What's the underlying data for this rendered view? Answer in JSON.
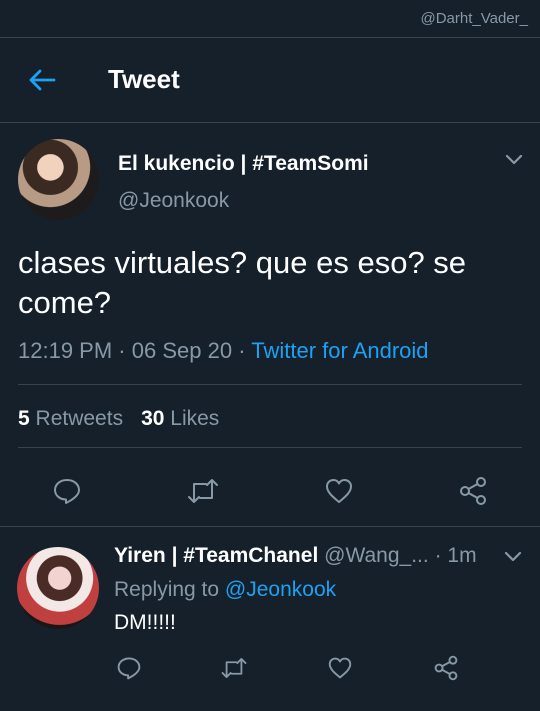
{
  "watermark": "@Darht_Vader_",
  "header": {
    "title": "Tweet",
    "back_icon": "arrow-left-icon",
    "accent": "#1da1f2"
  },
  "tweet": {
    "author_name": "El kukencio | #TeamSomi",
    "author_handle": "@Jeonkook",
    "text": "clases virtuales? que es eso? se come?",
    "time": "12:19 PM",
    "dot1": "·",
    "date": "06 Sep 20",
    "dot2": "·",
    "source": "Twitter for Android",
    "retweets_count": "5",
    "retweets_label": "Retweets",
    "likes_count": "30",
    "likes_label": "Likes"
  },
  "reply": {
    "author_name": "Yiren | #TeamChanel",
    "author_handle": "@Wang_...",
    "dot": "·",
    "time": "1m",
    "replying_prefix": "Replying to",
    "replying_to": "@Jeonkook",
    "text": "DM!!!!!"
  },
  "colors": {
    "background": "#15202b",
    "divider": "#38444d",
    "muted": "#8899a6",
    "link": "#1da1f2"
  }
}
